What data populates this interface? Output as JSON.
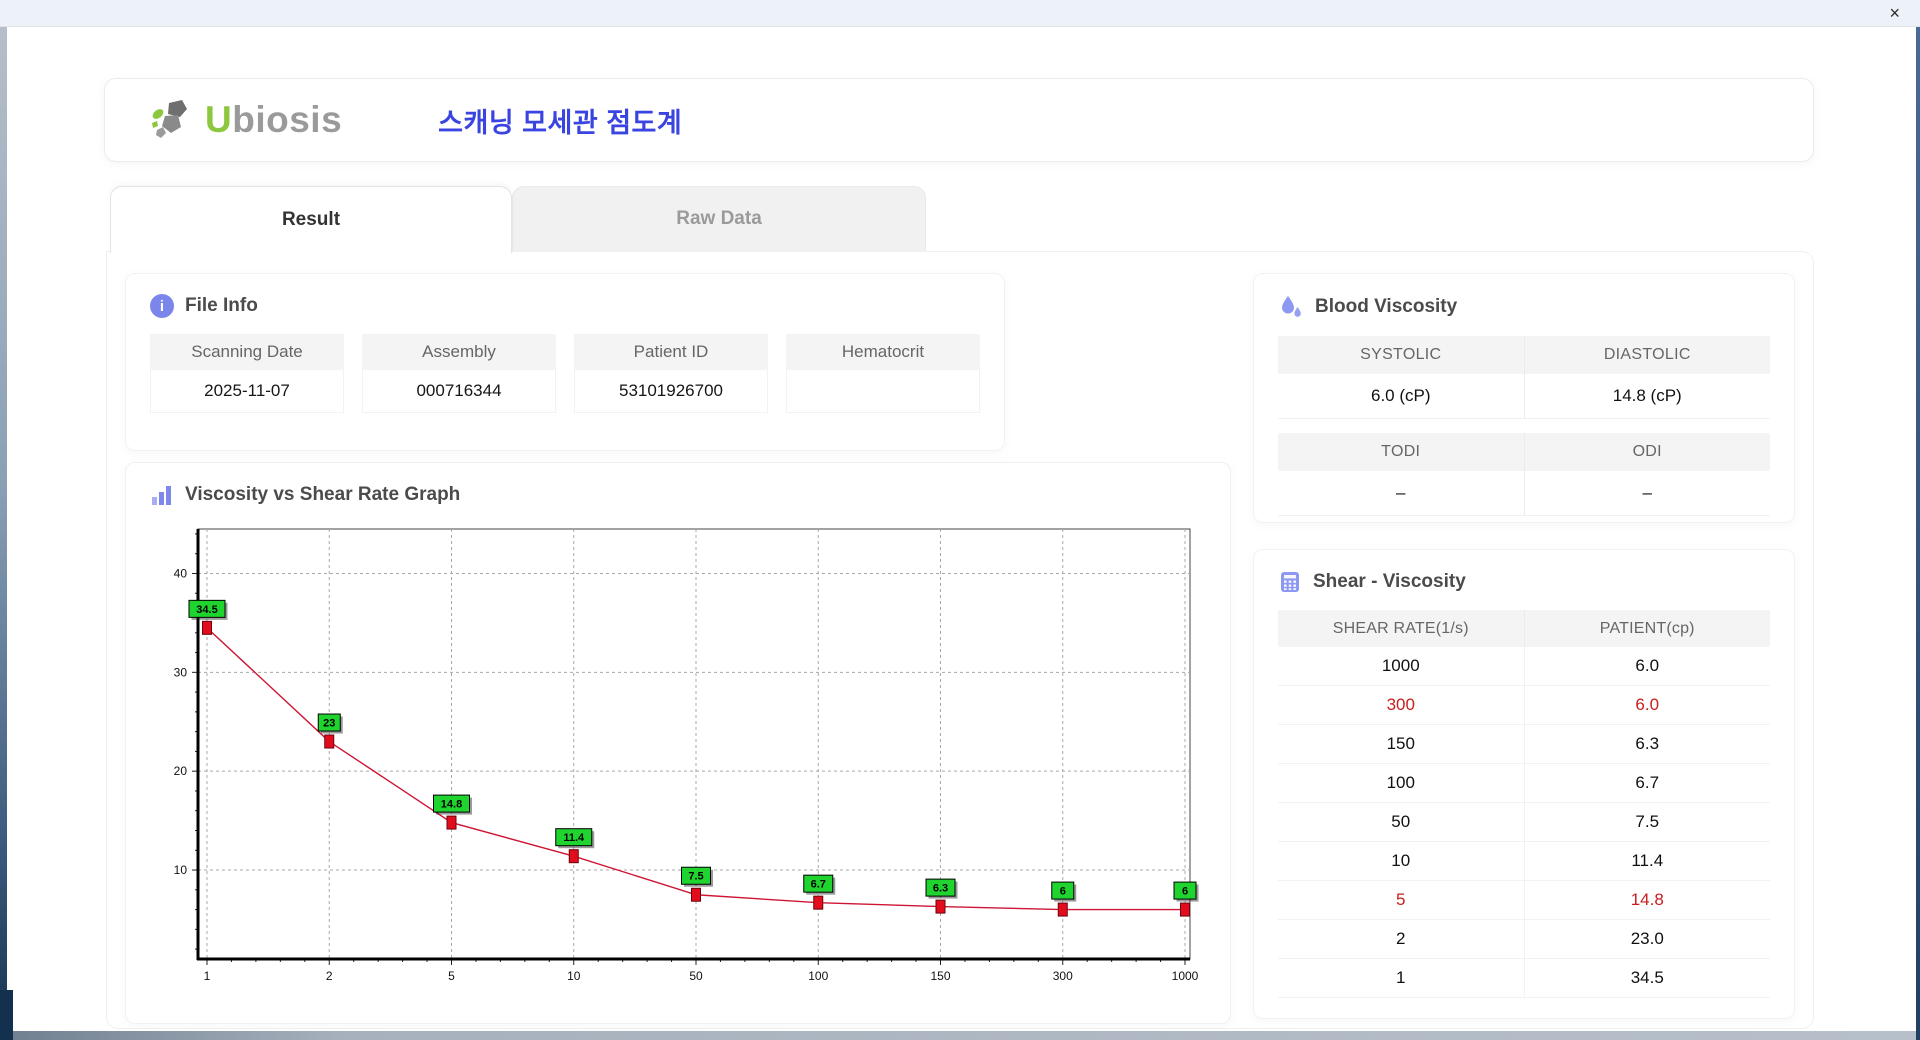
{
  "window": {
    "close_label": "×"
  },
  "header": {
    "logo_u": "U",
    "logo_rest": "biosis",
    "title": "스캐닝 모세관 점도계"
  },
  "tabs": [
    {
      "label": "Result",
      "active": true
    },
    {
      "label": "Raw Data",
      "active": false
    }
  ],
  "file_info": {
    "title": "File Info",
    "fields": [
      {
        "label": "Scanning Date",
        "value": "2025-11-07"
      },
      {
        "label": "Assembly",
        "value": "000716344"
      },
      {
        "label": "Patient ID",
        "value": "53101926700"
      },
      {
        "label": "Hematocrit",
        "value": ""
      }
    ]
  },
  "blood_viscosity": {
    "title": "Blood Viscosity",
    "groups": [
      {
        "cols": [
          {
            "header": "SYSTOLIC",
            "value": "6.0 (cP)"
          },
          {
            "header": "DIASTOLIC",
            "value": "14.8 (cP)"
          }
        ]
      },
      {
        "cols": [
          {
            "header": "TODI",
            "value": "–"
          },
          {
            "header": "ODI",
            "value": "–"
          }
        ]
      }
    ]
  },
  "shear_viscosity": {
    "title": "Shear - Viscosity",
    "columns": [
      "SHEAR RATE(1/s)",
      "PATIENT(cp)"
    ],
    "rows": [
      {
        "shear_rate": "1000",
        "patient": "6.0",
        "highlight": false
      },
      {
        "shear_rate": "300",
        "patient": "6.0",
        "highlight": true
      },
      {
        "shear_rate": "150",
        "patient": "6.3",
        "highlight": false
      },
      {
        "shear_rate": "100",
        "patient": "6.7",
        "highlight": false
      },
      {
        "shear_rate": "50",
        "patient": "7.5",
        "highlight": false
      },
      {
        "shear_rate": "10",
        "patient": "11.4",
        "highlight": false
      },
      {
        "shear_rate": "5",
        "patient": "14.8",
        "highlight": true
      },
      {
        "shear_rate": "2",
        "patient": "23.0",
        "highlight": false
      },
      {
        "shear_rate": "1",
        "patient": "34.5",
        "highlight": false
      }
    ],
    "highlight_color": "#c81e1e"
  },
  "chart_data": {
    "type": "line",
    "title": "Viscosity vs Shear Rate Graph",
    "x_categories": [
      "1",
      "2",
      "5",
      "10",
      "50",
      "100",
      "150",
      "300",
      "1000"
    ],
    "values": [
      34.5,
      23,
      14.8,
      11.4,
      7.5,
      6.7,
      6.3,
      6,
      6
    ],
    "point_labels": [
      "34.5",
      "23",
      "14.8",
      "11.4",
      "7.5",
      "6.7",
      "6.3",
      "6",
      "6"
    ],
    "xlabel": "",
    "ylabel": "",
    "y_ticks": [
      10,
      20,
      30,
      40
    ],
    "ylim": [
      1,
      44.5
    ],
    "x_scale": "categorical-equal-spacing",
    "grid": "dashed",
    "legend": "none",
    "line_color": "#ce1634",
    "marker_color": "#e20c1c",
    "marker_border": "#6b0410",
    "label_bg": "#1fd42e",
    "label_border": "#000000"
  },
  "colors": {
    "accent_purple": "#7b86ea",
    "title_blue": "#3a45e1",
    "logo_green": "#8dc63f",
    "logo_gray": "#9a9a9a",
    "table_header_bg": "#f4f4f5",
    "red_highlight": "#c81e1e"
  }
}
